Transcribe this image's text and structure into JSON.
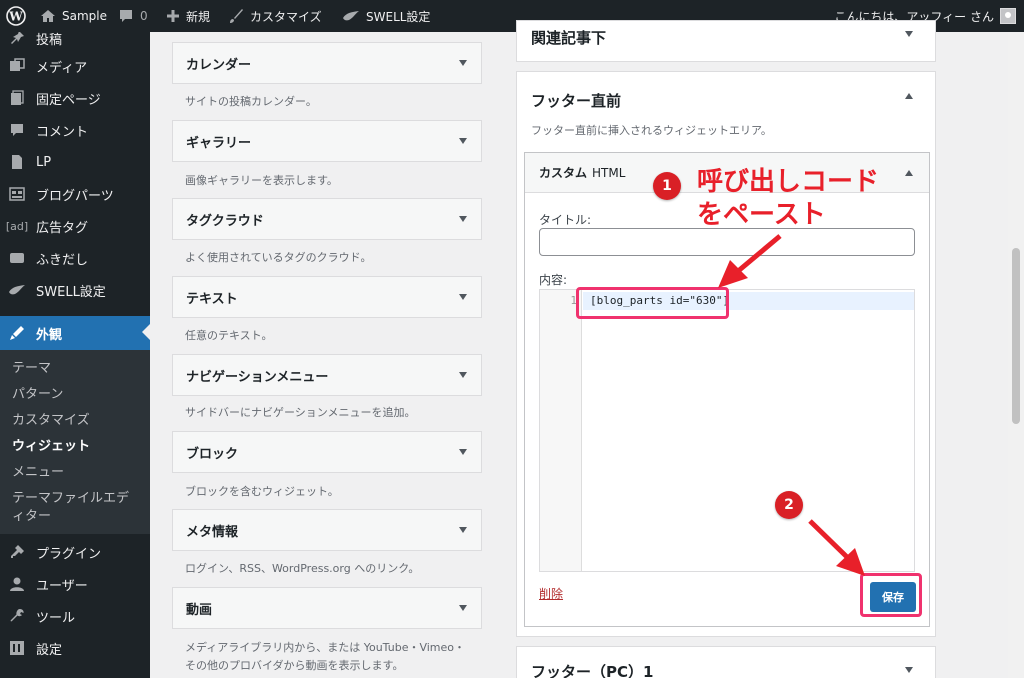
{
  "admin_bar": {
    "site_name": "Sample",
    "comment_count": "0",
    "new_label": "新規",
    "customize_label": "カスタマイズ",
    "swell_label": "SWELL設定",
    "greeting": "こんにちは、アッフィー さん"
  },
  "sidebar": {
    "items": [
      {
        "label": "投稿",
        "icon": "pin-icon"
      },
      {
        "label": "メディア",
        "icon": "media-icon"
      },
      {
        "label": "固定ページ",
        "icon": "page-icon"
      },
      {
        "label": "コメント",
        "icon": "comment-icon"
      },
      {
        "label": "LP",
        "icon": "lp-icon"
      },
      {
        "label": "ブログパーツ",
        "icon": "blog-parts-icon"
      },
      {
        "label": "広告タグ",
        "icon": "ad-icon"
      },
      {
        "label": "ふきだし",
        "icon": "balloon-icon"
      },
      {
        "label": "SWELL設定",
        "icon": "swell-icon"
      },
      {
        "label": "外観",
        "icon": "appearance-icon"
      },
      {
        "label": "プラグイン",
        "icon": "plugin-icon"
      },
      {
        "label": "ユーザー",
        "icon": "user-icon"
      },
      {
        "label": "ツール",
        "icon": "tool-icon"
      },
      {
        "label": "設定",
        "icon": "settings-icon"
      }
    ],
    "ad_icon_text": "[ad]",
    "submenu": [
      "テーマ",
      "パターン",
      "カスタマイズ",
      "ウィジェット",
      "メニュー",
      "テーマファイルエディター"
    ]
  },
  "widgets": [
    {
      "title": "カレンダー",
      "desc": "サイトの投稿カレンダー。"
    },
    {
      "title": "ギャラリー",
      "desc": "画像ギャラリーを表示します。"
    },
    {
      "title": "タグクラウド",
      "desc": "よく使用されているタグのクラウド。"
    },
    {
      "title": "テキスト",
      "desc": "任意のテキスト。"
    },
    {
      "title": "ナビゲーションメニュー",
      "desc": "サイドバーにナビゲーションメニューを追加。"
    },
    {
      "title": "ブロック",
      "desc": "ブロックを含むウィジェット。"
    },
    {
      "title": "メタ情報",
      "desc": "ログイン、RSS、WordPress.org へのリンク。"
    },
    {
      "title": "動画",
      "desc": "メディアライブラリ内から、または YouTube・Vimeo・その他のプロバイダから動画を表示します。"
    }
  ],
  "areas": {
    "related_title": "関連記事下",
    "footer_before_title": "フッター直前",
    "footer_before_desc": "フッター直前に挿入されるウィジェットエリア。",
    "footer_pc_title": "フッター（PC）1"
  },
  "custom_html": {
    "title": "カスタム",
    "subtitle": "HTML",
    "title_label": "タイトル:",
    "title_value": "",
    "content_label": "内容:",
    "line_number": "1",
    "code": "[blog_parts id=\"630\"]",
    "delete_label": "削除",
    "save_label": "保存"
  },
  "annotations": {
    "badge1": "1",
    "badge2": "2",
    "callout_line1": "呼び出しコード",
    "callout_line2": "をペースト",
    "color": "#e8202a"
  }
}
